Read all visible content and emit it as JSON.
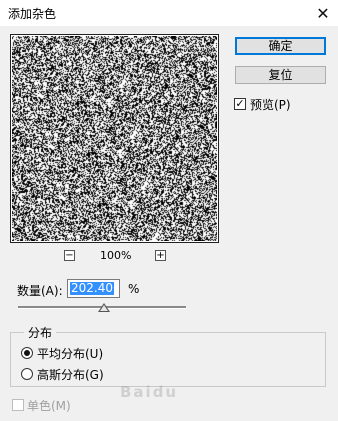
{
  "window": {
    "title": "添加杂色",
    "close_glyph": "✕"
  },
  "preview": {
    "zoom_level": "100%",
    "zoom_out_glyph": "−",
    "zoom_in_glyph": "+"
  },
  "buttons": {
    "ok": "确定",
    "reset": "复位"
  },
  "options": {
    "preview_label": "预览(P)",
    "preview_checked": true,
    "amount_label": "数量(A):",
    "amount_value": "202.40",
    "amount_unit": "%",
    "amount_slider_fraction": 0.51
  },
  "distribution": {
    "group_title": "分布",
    "uniform_label": "平均分布(U)",
    "gaussian_label": "高斯分布(G)",
    "selected": "uniform"
  },
  "monochromatic": {
    "label": "单色(M)",
    "checked": false,
    "disabled": true
  },
  "watermark": "Baidu"
}
